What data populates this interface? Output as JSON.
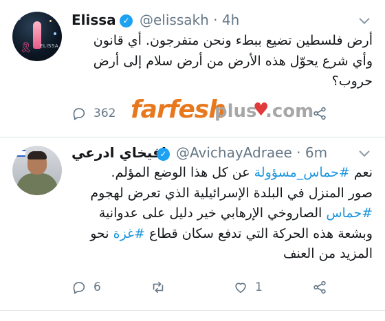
{
  "tweets": [
    {
      "display_name": "Elissa",
      "handle": "@elissakh",
      "separator": "·",
      "time": "4h",
      "avatar_text": "ELISSA",
      "text_lines": [
        [
          {
            "t": "أرض فلسطين تضيع ببطء ونحن متفرجون. أي قانون"
          }
        ],
        [
          {
            "t": "وأي شرع يحوّل هذه الأرض من أرض سلام إلى أرض"
          }
        ],
        [
          {
            "t": "حروب؟"
          }
        ]
      ],
      "actions": {
        "reply_count": "362"
      }
    },
    {
      "display_name": "افيخاي ادرعي",
      "handle": "@AvichayAdraee",
      "separator": "·",
      "time": "6m",
      "text_lines": [
        [
          {
            "t": "نعم "
          },
          {
            "t": "#حماس_مسؤولة",
            "tag": true
          },
          {
            "t": " عن كل هذا الوضع المؤلم."
          }
        ],
        [
          {
            "t": "صور المنزل في البلدة الإسرائيلية الذي تعرض لهجوم"
          }
        ],
        [
          {
            "t": "#حماس",
            "tag": true
          },
          {
            "t": " الصاروخي الإرهابي خير دليل على عدوانية"
          }
        ],
        [
          {
            "t": "وبشعة هذه الحركة التي تدفع سكان قطاع "
          },
          {
            "t": "#غزة",
            "tag": true
          },
          {
            "t": " نحو"
          }
        ],
        [
          {
            "t": "المزيد من العنف"
          }
        ]
      ],
      "actions": {
        "reply_count": "6",
        "like_count": "1"
      }
    }
  ],
  "watermark": {
    "far": "farfesh",
    "plus": "plus",
    "heart": "♥",
    "com": ".com"
  },
  "colors": {
    "accent": "#1da1f2",
    "hashtag": "#1b95e0",
    "muted": "#657786",
    "watermark_orange": "#e8781e"
  },
  "icons": [
    "verified-badge-icon",
    "chevron-down-icon",
    "reply-icon",
    "retweet-icon",
    "like-icon",
    "share-icon"
  ]
}
